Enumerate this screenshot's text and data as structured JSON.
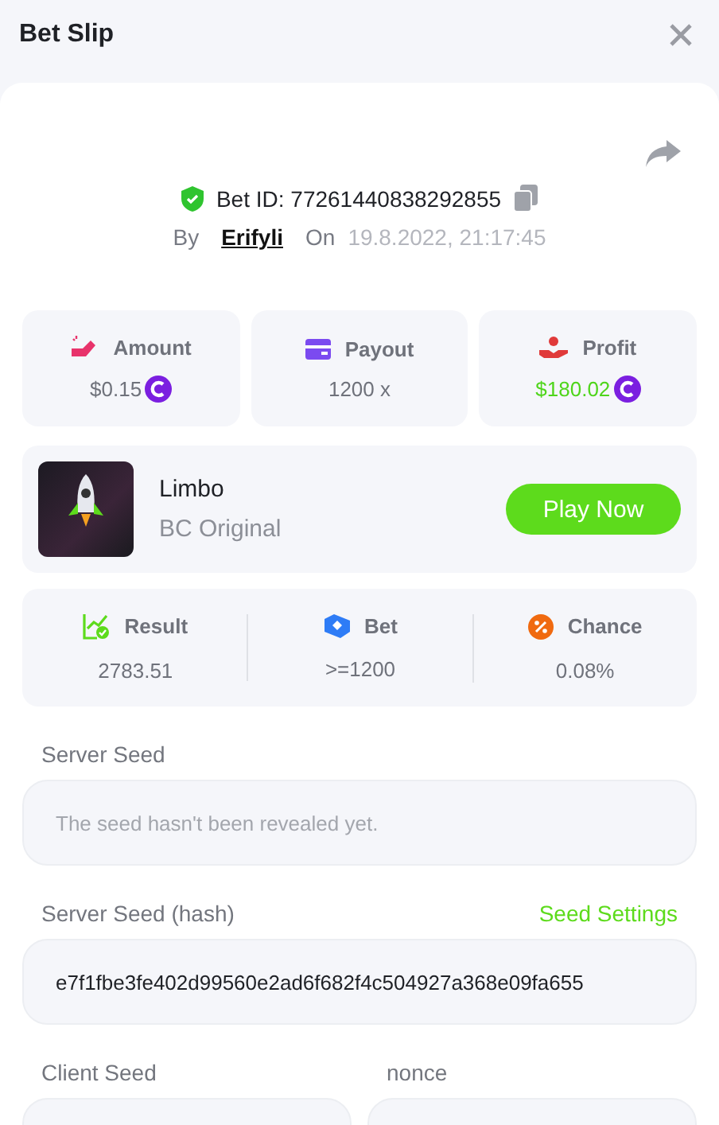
{
  "header": {
    "title": "Bet Slip"
  },
  "bet": {
    "id_text": "Bet ID: 77261440838292855",
    "by_label": "By",
    "user": "Erifyli",
    "on_label": "On",
    "date": "19.8.2022, 21:17:45"
  },
  "stats": [
    {
      "kind": "amount",
      "label": "Amount",
      "value": "$0.15",
      "coin": true
    },
    {
      "kind": "payout",
      "label": "Payout",
      "value": "1200 x",
      "coin": false
    },
    {
      "kind": "profit",
      "label": "Profit",
      "value": "$180.02",
      "coin": true
    }
  ],
  "game": {
    "name": "Limbo",
    "provider": "BC Original",
    "button": "Play Now"
  },
  "details": [
    {
      "kind": "result",
      "label": "Result",
      "value": "2783.51"
    },
    {
      "kind": "bet",
      "label": "Bet",
      "value": ">=1200"
    },
    {
      "kind": "chance",
      "label": "Chance",
      "value": "0.08%"
    }
  ],
  "server_seed": {
    "label": "Server Seed",
    "placeholder": "The seed hasn't been revealed yet."
  },
  "hash": {
    "label": "Server Seed (hash)",
    "link": "Seed Settings",
    "value": "e7f1fbe3fe402d99560e2ad6f682f4c504927a368e09fa655"
  },
  "client_seed": {
    "label": "Client Seed"
  },
  "nonce": {
    "label": "nonce"
  }
}
